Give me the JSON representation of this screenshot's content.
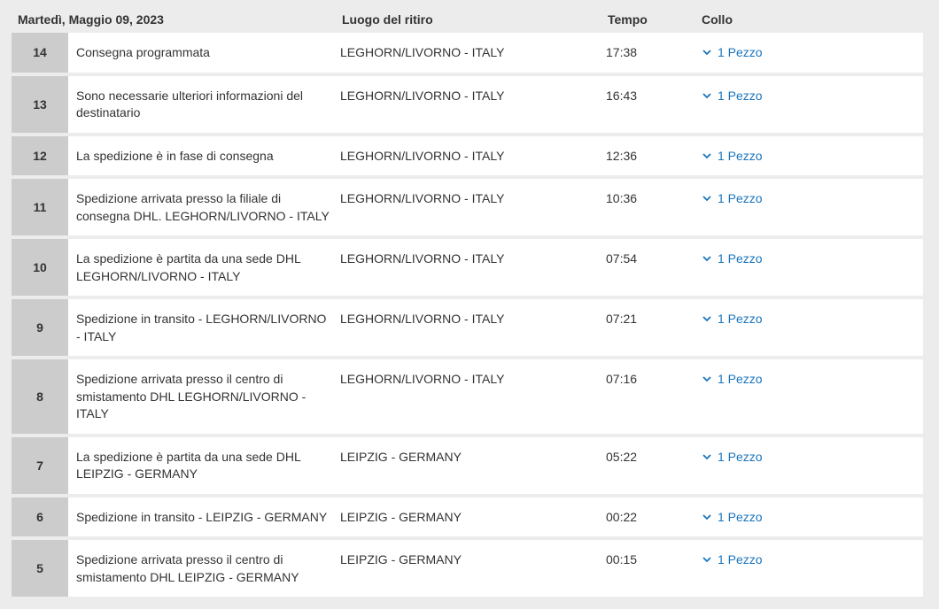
{
  "header": {
    "date": "Martedì, Maggio 09, 2023",
    "location_col": "Luogo del ritiro",
    "time_col": "Tempo",
    "package_col": "Collo"
  },
  "rows": [
    {
      "num": "14",
      "desc": "Consegna programmata",
      "location": "LEGHORN/LIVORNO - ITALY",
      "time": "17:38",
      "package": "1 Pezzo"
    },
    {
      "num": "13",
      "desc": "Sono necessarie ulteriori informazioni del destinatario",
      "location": "LEGHORN/LIVORNO - ITALY",
      "time": "16:43",
      "package": "1 Pezzo"
    },
    {
      "num": "12",
      "desc": "La spedizione è in fase di consegna",
      "location": "LEGHORN/LIVORNO - ITALY",
      "time": "12:36",
      "package": "1 Pezzo"
    },
    {
      "num": "11",
      "desc": "Spedizione arrivata presso la filiale di consegna DHL. LEGHORN/LIVORNO - ITALY",
      "location": "LEGHORN/LIVORNO - ITALY",
      "time": "10:36",
      "package": "1 Pezzo"
    },
    {
      "num": "10",
      "desc": "La spedizione è partita da una sede DHL LEGHORN/LIVORNO - ITALY",
      "location": "LEGHORN/LIVORNO - ITALY",
      "time": "07:54",
      "package": "1 Pezzo"
    },
    {
      "num": "9",
      "desc": "Spedizione in transito - LEGHORN/LIVORNO - ITALY",
      "location": "LEGHORN/LIVORNO - ITALY",
      "time": "07:21",
      "package": "1 Pezzo"
    },
    {
      "num": "8",
      "desc": "Spedizione arrivata presso il centro di smistamento DHL LEGHORN/LIVORNO - ITALY",
      "location": "LEGHORN/LIVORNO - ITALY",
      "time": "07:16",
      "package": "1 Pezzo"
    },
    {
      "num": "7",
      "desc": "La spedizione è partita da una sede DHL LEIPZIG - GERMANY",
      "location": "LEIPZIG - GERMANY",
      "time": "05:22",
      "package": "1 Pezzo"
    },
    {
      "num": "6",
      "desc": "Spedizione in transito - LEIPZIG - GERMANY",
      "location": "LEIPZIG - GERMANY",
      "time": "00:22",
      "package": "1 Pezzo"
    },
    {
      "num": "5",
      "desc": "Spedizione arrivata presso il centro di smistamento DHL LEIPZIG - GERMANY",
      "location": "LEIPZIG - GERMANY",
      "time": "00:15",
      "package": "1 Pezzo"
    }
  ],
  "colors": {
    "link": "#1a75bc",
    "number_cell": "#cccccc",
    "background": "#ececec"
  },
  "icons": {
    "package_toggle": "chevron-down-icon"
  }
}
